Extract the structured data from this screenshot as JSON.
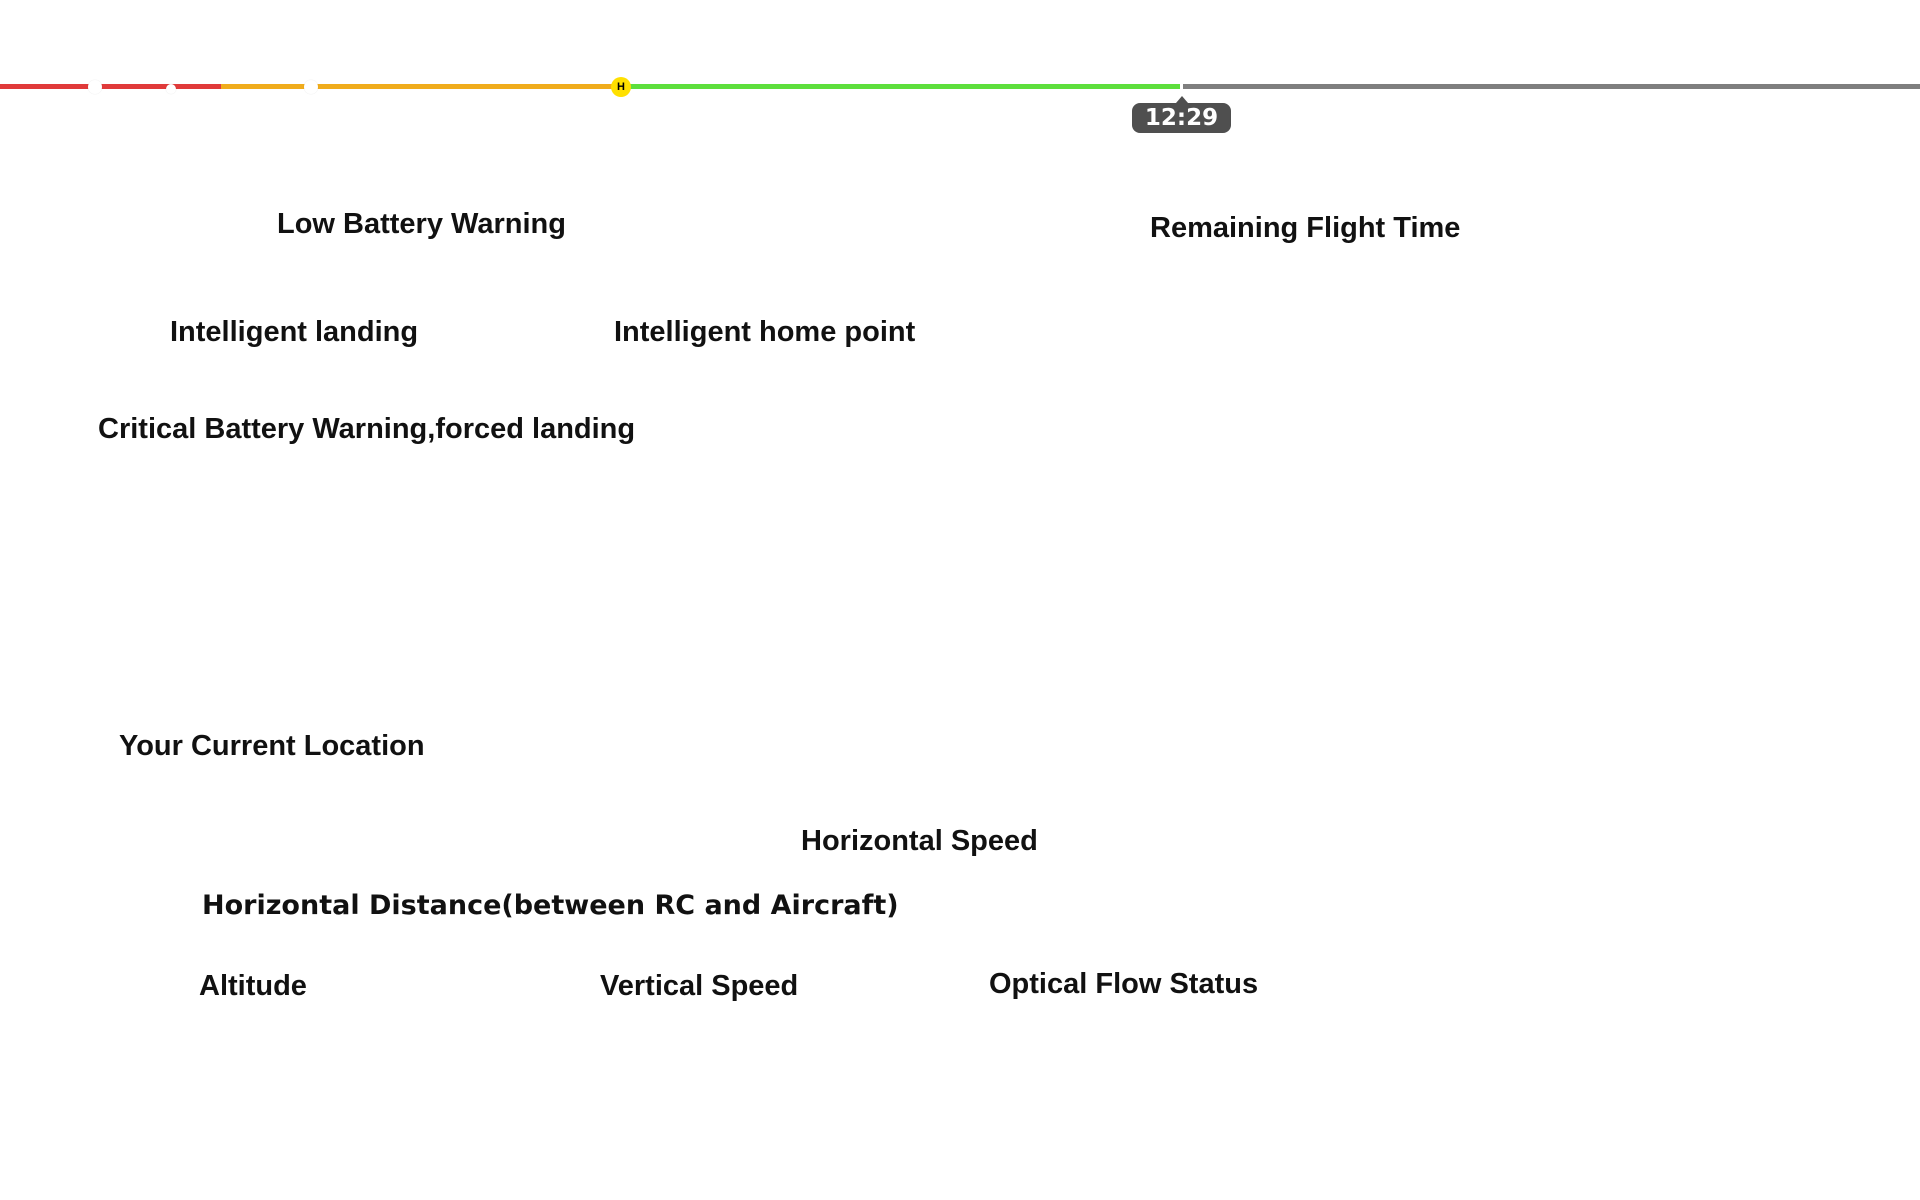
{
  "battery_bar": {
    "colors": {
      "critical": "#e03a3a",
      "low": "#f0ac1c",
      "normal": "#5ddf3c",
      "remaining": "#7f7f7f",
      "home_marker": "#ffe000",
      "badge": "#4f4f4f"
    },
    "home_marker_label": "H",
    "remaining_time": "12:29"
  },
  "labels": {
    "low_battery_warning": "Low Battery Warning",
    "remaining_flight_time": "Remaining Flight Time",
    "intelligent_landing": "Intelligent landing",
    "intelligent_home_point": "Intelligent home point",
    "critical_battery_warning": "Critical Battery Warning,forced landing",
    "your_current_location": "Your Current Location",
    "horizontal_speed": "Horizontal Speed",
    "horizontal_distance": "Horizontal Distance(between RC and Aircraft)",
    "altitude": "Altitude",
    "vertical_speed": "Vertical Speed",
    "optical_flow_status": "Optical Flow Status"
  }
}
